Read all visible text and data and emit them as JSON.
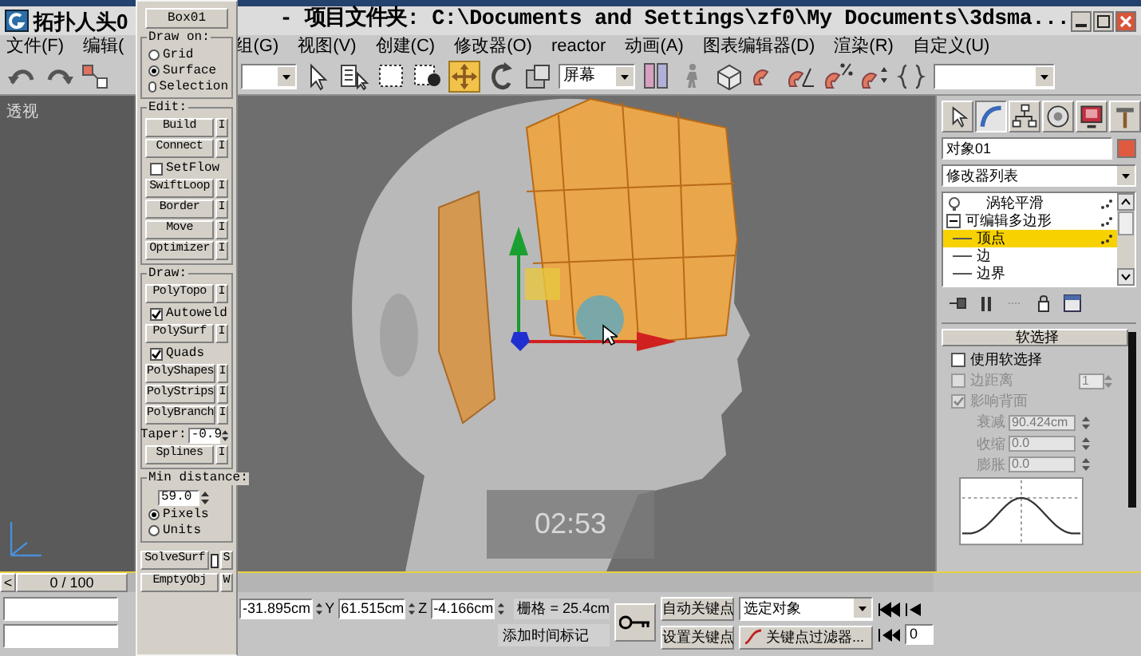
{
  "title_bar": {
    "title": "拓扑人头0",
    "path": "- 项目文件夹: C:\\Documents and Settings\\zf0\\My Documents\\3dsma..."
  },
  "menu_bar": [
    {
      "label": "文件(F)"
    },
    {
      "label": "编辑("
    },
    {
      "label": "组(G)"
    },
    {
      "label": "视图(V)"
    },
    {
      "label": "创建(C)"
    },
    {
      "label": "修改器(O)"
    },
    {
      "label": "reactor"
    },
    {
      "label": "动画(A)"
    },
    {
      "label": "图表编辑器(D)"
    },
    {
      "label": "渲染(R)"
    },
    {
      "label": "自定义(U)"
    }
  ],
  "toolbar": [
    {
      "kind": "undo",
      "selected": false
    },
    {
      "kind": "redo",
      "selected": false
    },
    {
      "kind": "link",
      "selected": false
    },
    {
      "kind": "dropdown"
    },
    {
      "kind": "select",
      "selected": false
    },
    {
      "kind": "select_by_name",
      "selected": false
    },
    {
      "kind": "rect_region",
      "selected": false
    },
    {
      "kind": "window_crossing",
      "selected": false
    },
    {
      "kind": "move",
      "selected": true
    },
    {
      "kind": "rotate",
      "selected": false
    },
    {
      "kind": "scale",
      "selected": false
    },
    {
      "kind": "dropdown",
      "value": "屏幕"
    },
    {
      "kind": "pivot",
      "selected": false
    },
    {
      "kind": "figure",
      "selected": false
    },
    {
      "kind": "box",
      "selected": false
    },
    {
      "kind": "snap",
      "selected": false
    },
    {
      "kind": "angle_snap",
      "selected": false
    },
    {
      "kind": "percent_snap",
      "selected": false
    },
    {
      "kind": "spinner_snap",
      "selected": false
    },
    {
      "kind": "named_sets",
      "selected": false
    },
    {
      "kind": "dropdown"
    }
  ],
  "viewport": {
    "label": "透视",
    "timer": "02:53"
  },
  "script_panel": {
    "object_button": "Box01",
    "draw_on": {
      "label": "Draw on:",
      "options": [
        {
          "label": "Grid",
          "selected": false
        },
        {
          "label": "Surface",
          "selected": true
        },
        {
          "label": "Selection",
          "selected": false
        }
      ]
    },
    "edit": {
      "label": "Edit:",
      "items": [
        {
          "kind": "button",
          "label": "Build",
          "toggle": "I"
        },
        {
          "kind": "button",
          "label": "Connect",
          "toggle": "I"
        },
        {
          "kind": "checkbox",
          "label": "SetFlow",
          "checked": false
        },
        {
          "kind": "button",
          "label": "SwiftLoop",
          "toggle": "I"
        },
        {
          "kind": "button",
          "label": "Border",
          "toggle": "I"
        },
        {
          "kind": "button",
          "label": "Move",
          "toggle": "I"
        },
        {
          "kind": "button",
          "label": "Optimizer",
          "toggle": "I"
        }
      ]
    },
    "draw": {
      "label": "Draw:",
      "items": [
        {
          "kind": "button",
          "label": "PolyTopo",
          "toggle": "I"
        },
        {
          "kind": "checkbox",
          "label": "Autoweld",
          "checked": true
        },
        {
          "kind": "button",
          "label": "PolySurf",
          "toggle": "I"
        },
        {
          "kind": "checkbox",
          "label": "Quads",
          "checked": true
        },
        {
          "kind": "button",
          "label": "PolyShapes",
          "toggle": "I"
        },
        {
          "kind": "button",
          "label": "PolyStrips",
          "toggle": "I"
        },
        {
          "kind": "button",
          "label": "PolyBranch",
          "toggle": "I"
        },
        {
          "kind": "spinner",
          "label": "Taper:",
          "value": "-0.9"
        },
        {
          "kind": "button",
          "label": "Splines",
          "toggle": "I"
        }
      ]
    },
    "min_distance": {
      "label": "Min distance:",
      "value": "59.0",
      "options": [
        {
          "label": "Pixels",
          "selected": true
        },
        {
          "label": "Units",
          "selected": false
        }
      ]
    },
    "bottom_buttons": [
      {
        "label": "SolveSurf",
        "toggle": "S",
        "checked": false
      },
      {
        "label": "EmptyObj",
        "toggle": "W"
      }
    ]
  },
  "command_panel": {
    "tabs": [
      {
        "kind": "create",
        "selected": false
      },
      {
        "kind": "modify",
        "selected": true
      },
      {
        "kind": "hierarchy",
        "selected": false
      },
      {
        "kind": "motion",
        "selected": false
      },
      {
        "kind": "display",
        "selected": false
      },
      {
        "kind": "utilities",
        "selected": false
      }
    ],
    "object_name": "对象01",
    "modifier_list": "修改器列表",
    "stack": [
      {
        "label": "涡轮平滑",
        "kind": "modifier",
        "selected": false
      },
      {
        "label": "可编辑多边形",
        "kind": "base",
        "selected": false,
        "expanded": true,
        "children": [
          {
            "label": "顶点",
            "selected": true
          },
          {
            "label": "边",
            "selected": false
          },
          {
            "label": "边界",
            "selected": false
          }
        ]
      }
    ],
    "soft_selection": {
      "title": "软选择",
      "use": {
        "label": "使用软选择",
        "checked": false
      },
      "edge_distance": {
        "label": "边距离",
        "checked": false,
        "disabled": true,
        "value": "1"
      },
      "backface": {
        "label": "影响背面",
        "checked": true,
        "disabled": true
      },
      "params": [
        {
          "label": "衰减",
          "value": "90.424cm",
          "disabled": true
        },
        {
          "label": "收缩",
          "value": "0.0",
          "disabled": true
        },
        {
          "label": "膨胀",
          "value": "0.0",
          "disabled": true
        }
      ]
    }
  },
  "timeline": {
    "prev_button": "<",
    "frame": "0 / 100",
    "level": 0
  },
  "status_bar": {
    "coordinates": [
      {
        "value": "-31.895cm"
      },
      {
        "axis": "Y",
        "value": "61.515cm"
      },
      {
        "axis": "Z",
        "value": "-4.166cm"
      }
    ],
    "grid": "栅格 = 25.4cm",
    "time_tag": "添加时间标记",
    "auto_key": "自动关键点",
    "set_key": "设置关键点",
    "key_mode": "选定对象",
    "key_filters": "关键点过滤器...",
    "current_frame": "0"
  }
}
